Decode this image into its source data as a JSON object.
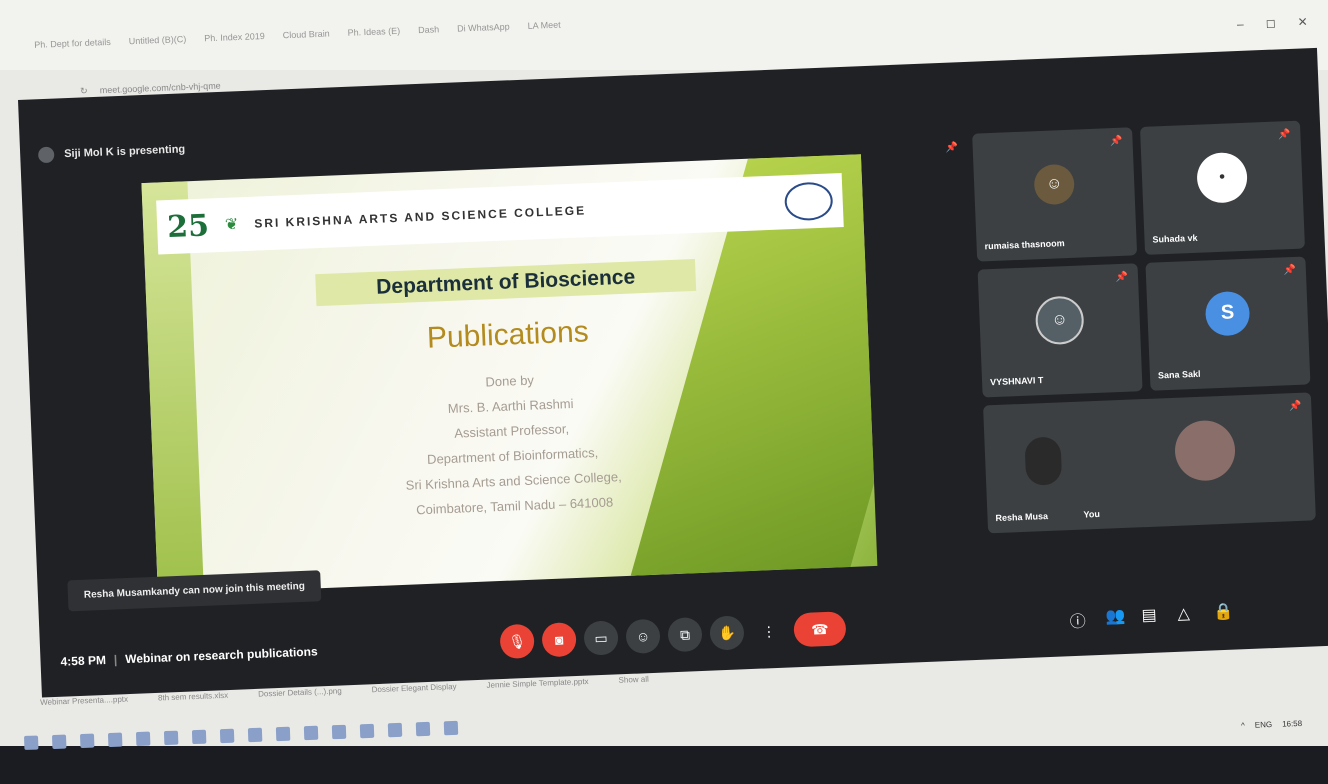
{
  "browser": {
    "tabs": [
      "Ph. Dept for details",
      "Untitled (B)(C)",
      "Ph. Index 2019",
      "Cloud Brain",
      "Ph. Ideas (E)",
      "Dash",
      "Di WhatsApp",
      "LA Meet"
    ],
    "url": "meet.google.com/cnb-vhj-qme",
    "window_controls": [
      "–",
      "◻",
      "✕"
    ]
  },
  "meet": {
    "presenting_label": "Siji Mol K is presenting",
    "slide": {
      "logo": "25",
      "college": "SRI KRISHNA ARTS AND SCIENCE COLLEGE",
      "department": "Department of Bioscience",
      "title": "Publications",
      "lines": [
        "Done by",
        "Mrs. B. Aarthi Rashmi",
        "Assistant Professor,",
        "Department of Bioinformatics,",
        "Sri Krishna Arts and Science College,",
        "Coimbatore, Tamil Nadu – 641008"
      ]
    },
    "toast": "Resha Musamkandy can now join this meeting",
    "participants": [
      {
        "name": "rumaisa thasnoom",
        "avatar": "img",
        "color": "#6b5a3e"
      },
      {
        "name": "Suhada vk",
        "avatar": "•",
        "color": "#ffffff"
      },
      {
        "name": "VYSHNAVI T",
        "avatar": "img",
        "color": "#556066"
      },
      {
        "name": "Sana Sakl",
        "avatar": "S",
        "color": "#4a90e2"
      },
      {
        "name": "Resha Musa",
        "avatar": "",
        "color": "#2a2a2a"
      },
      {
        "name": "You",
        "avatar": "img",
        "color": "#8a6e6a"
      }
    ],
    "time": "4:58 PM",
    "meeting_title": "Webinar on research publications",
    "controls": [
      "mic-off",
      "cam-off",
      "captions",
      "emoji",
      "present",
      "raise-hand",
      "more",
      "leave"
    ]
  },
  "downloads": [
    "Webinar Presenta....pptx",
    "8th sem results.xlsx",
    "Dossier Details (...).png",
    "Dossier Elegant Display",
    "Jennie Simple Template.pptx"
  ],
  "downloads_show_all": "Show all",
  "tray": [
    "^",
    "ENG",
    "16:58"
  ]
}
